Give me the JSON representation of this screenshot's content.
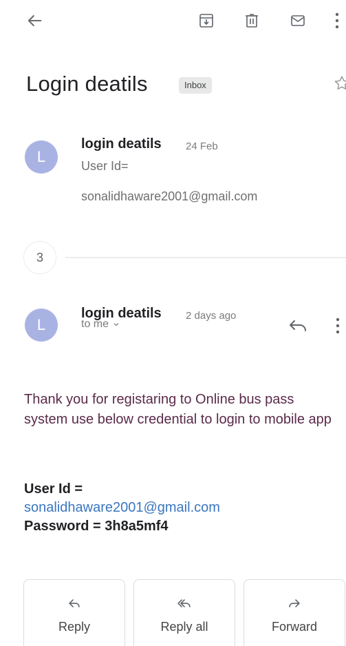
{
  "toolbar": {
    "back_icon": "arrow-left-icon",
    "archive_icon": "archive-icon",
    "delete_icon": "trash-icon",
    "mark_unread_icon": "mail-icon",
    "more_icon": "more-vert-icon"
  },
  "thread": {
    "subject": "Login deatils",
    "label": "Inbox",
    "star_icon": "star-outline-icon"
  },
  "message1": {
    "avatar_letter": "L",
    "sender": "login deatils",
    "date": "24 Feb",
    "snippet_line1": "User Id=",
    "snippet_line2": "sonalidhaware2001@gmail.com"
  },
  "collapsed": {
    "count": "3"
  },
  "message2": {
    "avatar_letter": "L",
    "sender": "login deatils",
    "date": "2 days ago",
    "recipient": "to me",
    "body": "Thank you for registaring to Online bus pass system use below credential to login to mobile app",
    "user_id_label": "User Id =",
    "user_id_value": "sonalidhaware2001@gmail.com",
    "password_line": "Password = 3h8a5mf4"
  },
  "actions": {
    "reply": "Reply",
    "reply_all": "Reply all",
    "forward": "Forward"
  },
  "colors": {
    "avatar": "#a9b3e3",
    "link": "#3a76c0",
    "body_text": "#5a2a4a"
  }
}
